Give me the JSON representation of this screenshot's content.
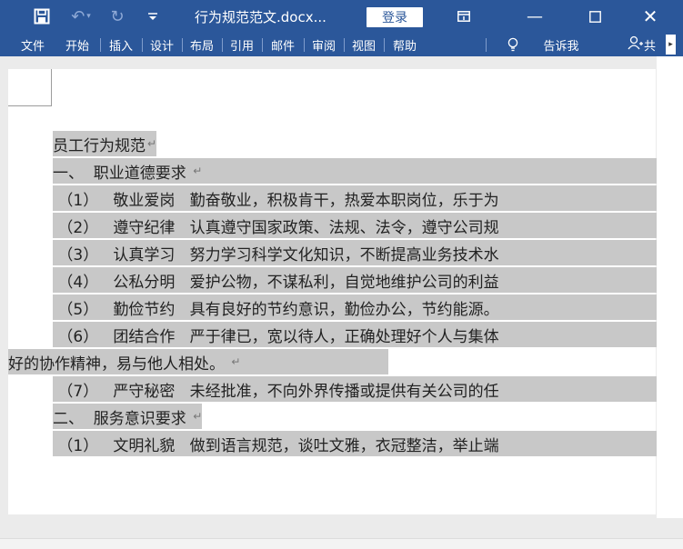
{
  "titlebar": {
    "doc_title": "行为规范范文.docx...",
    "login_label": "登录"
  },
  "icons": {
    "save": "save-icon",
    "undo": "undo-icon",
    "redo": "redo-icon",
    "qat": "customize-quick-access-icon",
    "ribbon_display": "ribbon-display-options-icon",
    "minimize": "minimize-icon",
    "maximize": "maximize-icon",
    "close": "close-icon",
    "tell": "lightbulb-icon",
    "share": "share-person-icon"
  },
  "tabs": [
    {
      "label": "文件"
    },
    {
      "label": "开始"
    },
    {
      "label": "插入"
    },
    {
      "label": "设计"
    },
    {
      "label": "布局"
    },
    {
      "label": "引用"
    },
    {
      "label": "邮件"
    },
    {
      "label": "审阅"
    },
    {
      "label": "视图"
    },
    {
      "label": "帮助"
    }
  ],
  "tell_me": "告诉我",
  "share_text": "共",
  "para_mark": "↵",
  "document": {
    "lines": [
      "员工行为规范",
      "一、  职业道德要求 ",
      " （1）   敬业爱岗   勤奋敬业，积极肯干，热爱本职岗位，乐于为",
      " （2）   遵守纪律   认真遵守国家政策、法规、法令，遵守公司规",
      " （3）   认真学习   努力学习科学文化知识，不断提高业务技术水",
      " （4）   公私分明   爱护公物，不谋私利，自觉地维护公司的利益",
      " （5）   勤俭节约   具有良好的节约意识，勤俭办公，节约能源。",
      " （6）   团结合作   严于律已，宽以待人，正确处理好个人与集体",
      "好的协作精神，易与他人相处。 ",
      " （7）   严守秘密   未经批准，不向外界传播或提供有关公司的任",
      "二、  服务意识要求 ",
      " （1）   文明礼貌   做到语言规范，谈吐文雅，衣冠整洁，举止端"
    ]
  }
}
